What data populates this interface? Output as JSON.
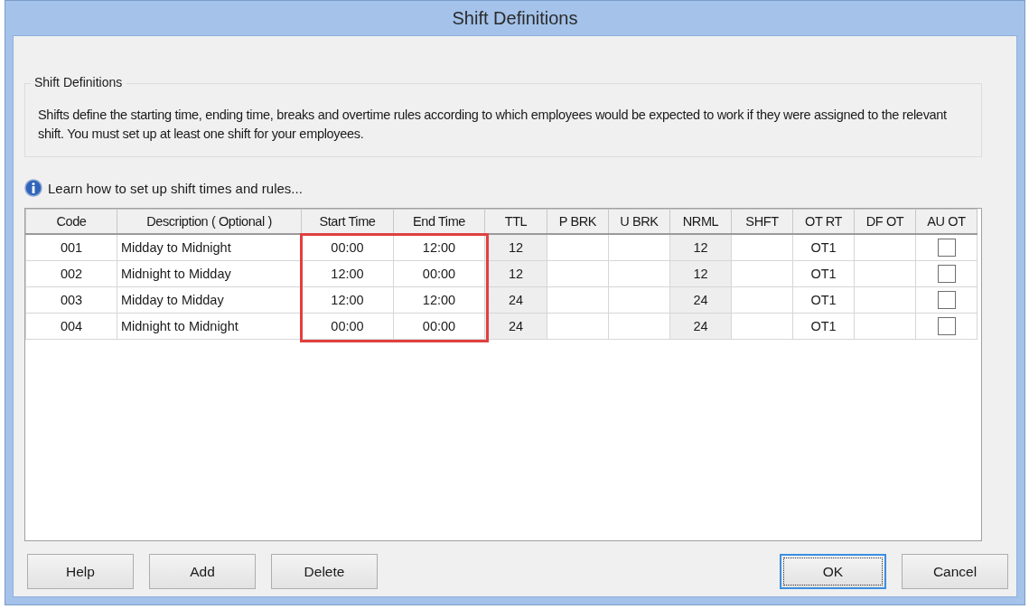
{
  "window": {
    "title": "Shift Definitions"
  },
  "group": {
    "title": "Shift Definitions",
    "text": "Shifts define the starting time, ending time, breaks and overtime rules according to which employees would be expected to work if they were assigned to the relevant shift. You must set up at least one shift for your employees."
  },
  "help_link": "Learn how to set up shift times and rules...",
  "table": {
    "columns": [
      {
        "label": "Code",
        "shaded": false,
        "highlighted": false
      },
      {
        "label": "Description ( Optional )",
        "shaded": false,
        "highlighted": false
      },
      {
        "label": "Start Time",
        "shaded": false,
        "highlighted": true
      },
      {
        "label": "End Time",
        "shaded": false,
        "highlighted": true
      },
      {
        "label": "TTL",
        "shaded": true,
        "highlighted": false
      },
      {
        "label": "P BRK",
        "shaded": false,
        "highlighted": false
      },
      {
        "label": "U BRK",
        "shaded": false,
        "highlighted": false
      },
      {
        "label": "NRML",
        "shaded": true,
        "highlighted": false
      },
      {
        "label": "SHFT",
        "shaded": false,
        "highlighted": false
      },
      {
        "label": "OT RT",
        "shaded": false,
        "highlighted": false
      },
      {
        "label": "DF OT",
        "shaded": false,
        "highlighted": false
      },
      {
        "label": "AU OT",
        "shaded": false,
        "highlighted": false
      }
    ],
    "rows": [
      {
        "code": "001",
        "description": "Midday to Midnight",
        "start": "00:00",
        "end": "12:00",
        "ttl": "12",
        "nrml": "12",
        "ot_rt": "OT1",
        "au_ot": false
      },
      {
        "code": "002",
        "description": "Midnight to Midday",
        "start": "12:00",
        "end": "00:00",
        "ttl": "12",
        "nrml": "12",
        "ot_rt": "OT1",
        "au_ot": false
      },
      {
        "code": "003",
        "description": "Midday to Midday",
        "start": "12:00",
        "end": "12:00",
        "ttl": "24",
        "nrml": "24",
        "ot_rt": "OT1",
        "au_ot": false
      },
      {
        "code": "004",
        "description": "Midnight to Midnight",
        "start": "00:00",
        "end": "00:00",
        "ttl": "24",
        "nrml": "24",
        "ot_rt": "OT1",
        "au_ot": false
      }
    ]
  },
  "buttons_left": [
    {
      "label": "Help"
    },
    {
      "label": "Add"
    },
    {
      "label": "Delete"
    }
  ],
  "buttons_right": [
    {
      "label": "OK",
      "default": true
    },
    {
      "label": "Cancel",
      "default": false
    }
  ]
}
